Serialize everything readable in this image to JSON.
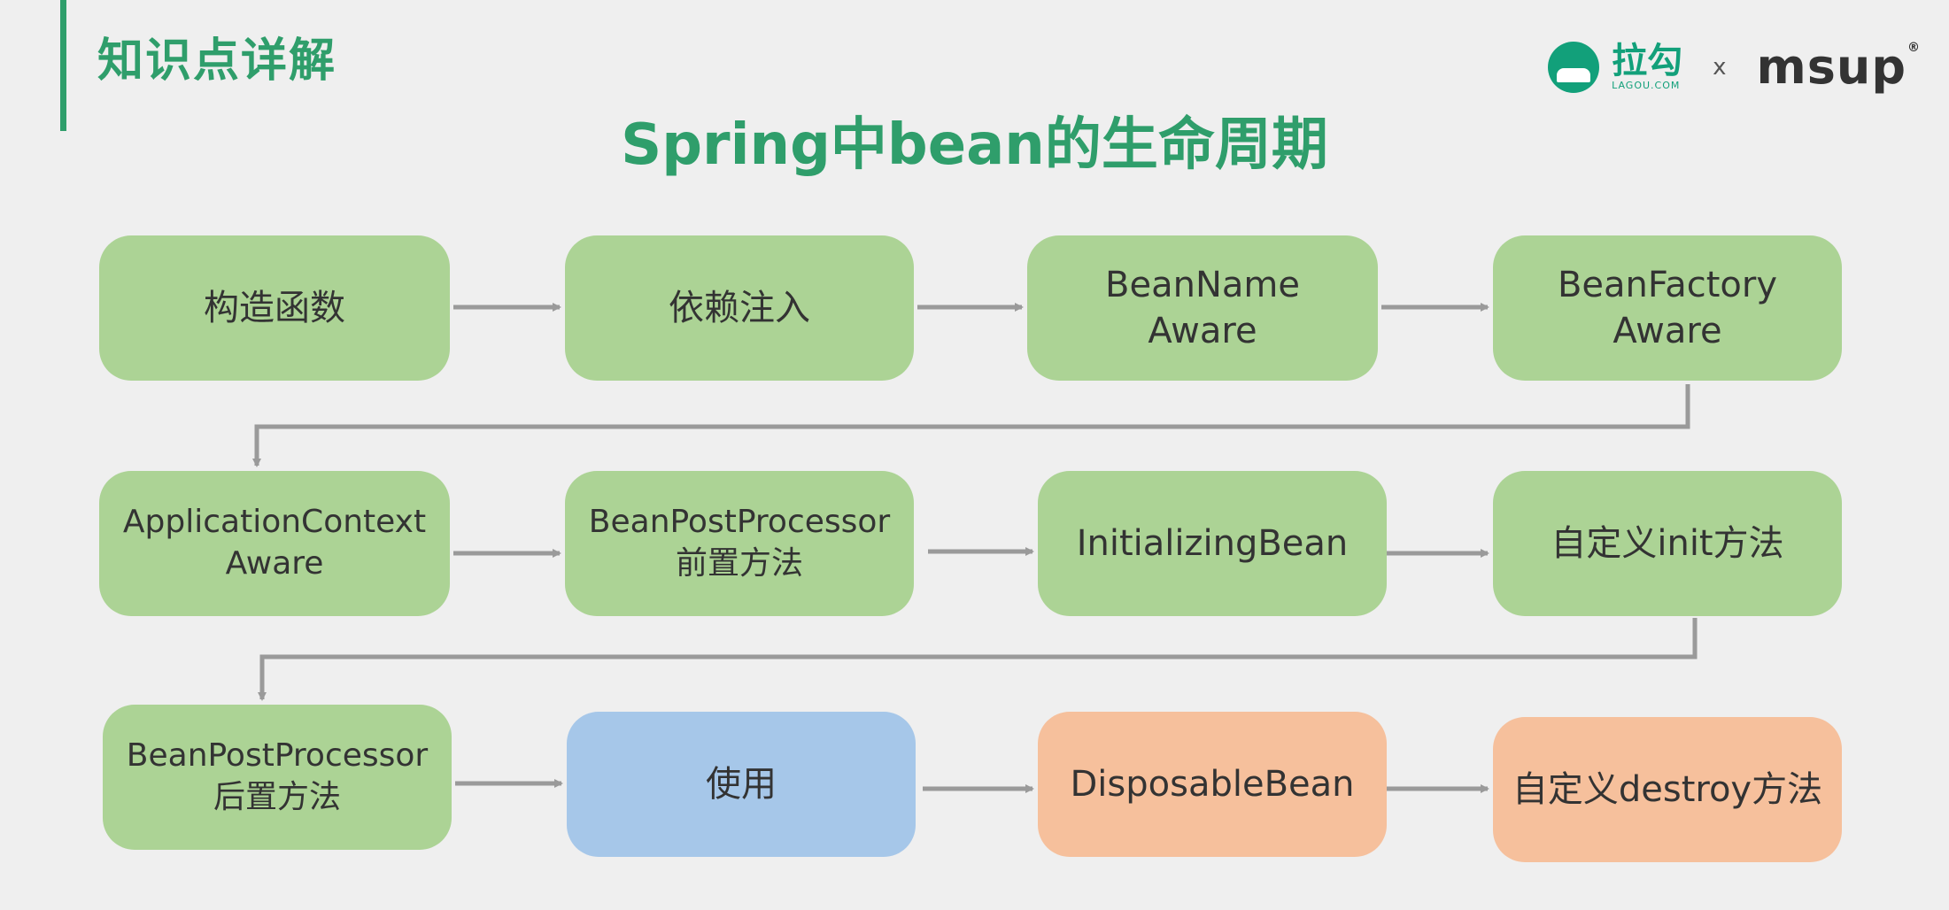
{
  "header": {
    "section_title": "知识点详解",
    "main_title": "Spring中bean的生命周期"
  },
  "logos": {
    "lagou_cn": "拉勾",
    "lagou_en": "LAGOU.COM",
    "times": "x",
    "msup": "msup",
    "registered": "®"
  },
  "colors": {
    "accent": "#2f9e6b",
    "green_box": "#acd395",
    "blue_box": "#a6c7e9",
    "orange_box": "#f6c09c",
    "arrow": "#9a9a9a"
  },
  "diagram": {
    "nodes": [
      {
        "id": "n1",
        "label": "构造函数",
        "color": "green"
      },
      {
        "id": "n2",
        "label": "依赖注入",
        "color": "green"
      },
      {
        "id": "n3",
        "label": "BeanName\nAware",
        "color": "green"
      },
      {
        "id": "n4",
        "label": "BeanFactory\nAware",
        "color": "green"
      },
      {
        "id": "n5",
        "label": "ApplicationContext\nAware",
        "color": "green"
      },
      {
        "id": "n6",
        "label": "BeanPostProcessor\n前置方法",
        "color": "green"
      },
      {
        "id": "n7",
        "label": "InitializingBean",
        "color": "green"
      },
      {
        "id": "n8",
        "label": "自定义init方法",
        "color": "green"
      },
      {
        "id": "n9",
        "label": "BeanPostProcessor\n后置方法",
        "color": "green"
      },
      {
        "id": "n10",
        "label": "使用",
        "color": "blue"
      },
      {
        "id": "n11",
        "label": "DisposableBean",
        "color": "orange"
      },
      {
        "id": "n12",
        "label": "自定义destroy方法",
        "color": "orange"
      }
    ],
    "edges": [
      [
        "n1",
        "n2"
      ],
      [
        "n2",
        "n3"
      ],
      [
        "n3",
        "n4"
      ],
      [
        "n4",
        "n5"
      ],
      [
        "n5",
        "n6"
      ],
      [
        "n6",
        "n7"
      ],
      [
        "n7",
        "n8"
      ],
      [
        "n8",
        "n9"
      ],
      [
        "n9",
        "n10"
      ],
      [
        "n10",
        "n11"
      ],
      [
        "n11",
        "n12"
      ]
    ]
  }
}
